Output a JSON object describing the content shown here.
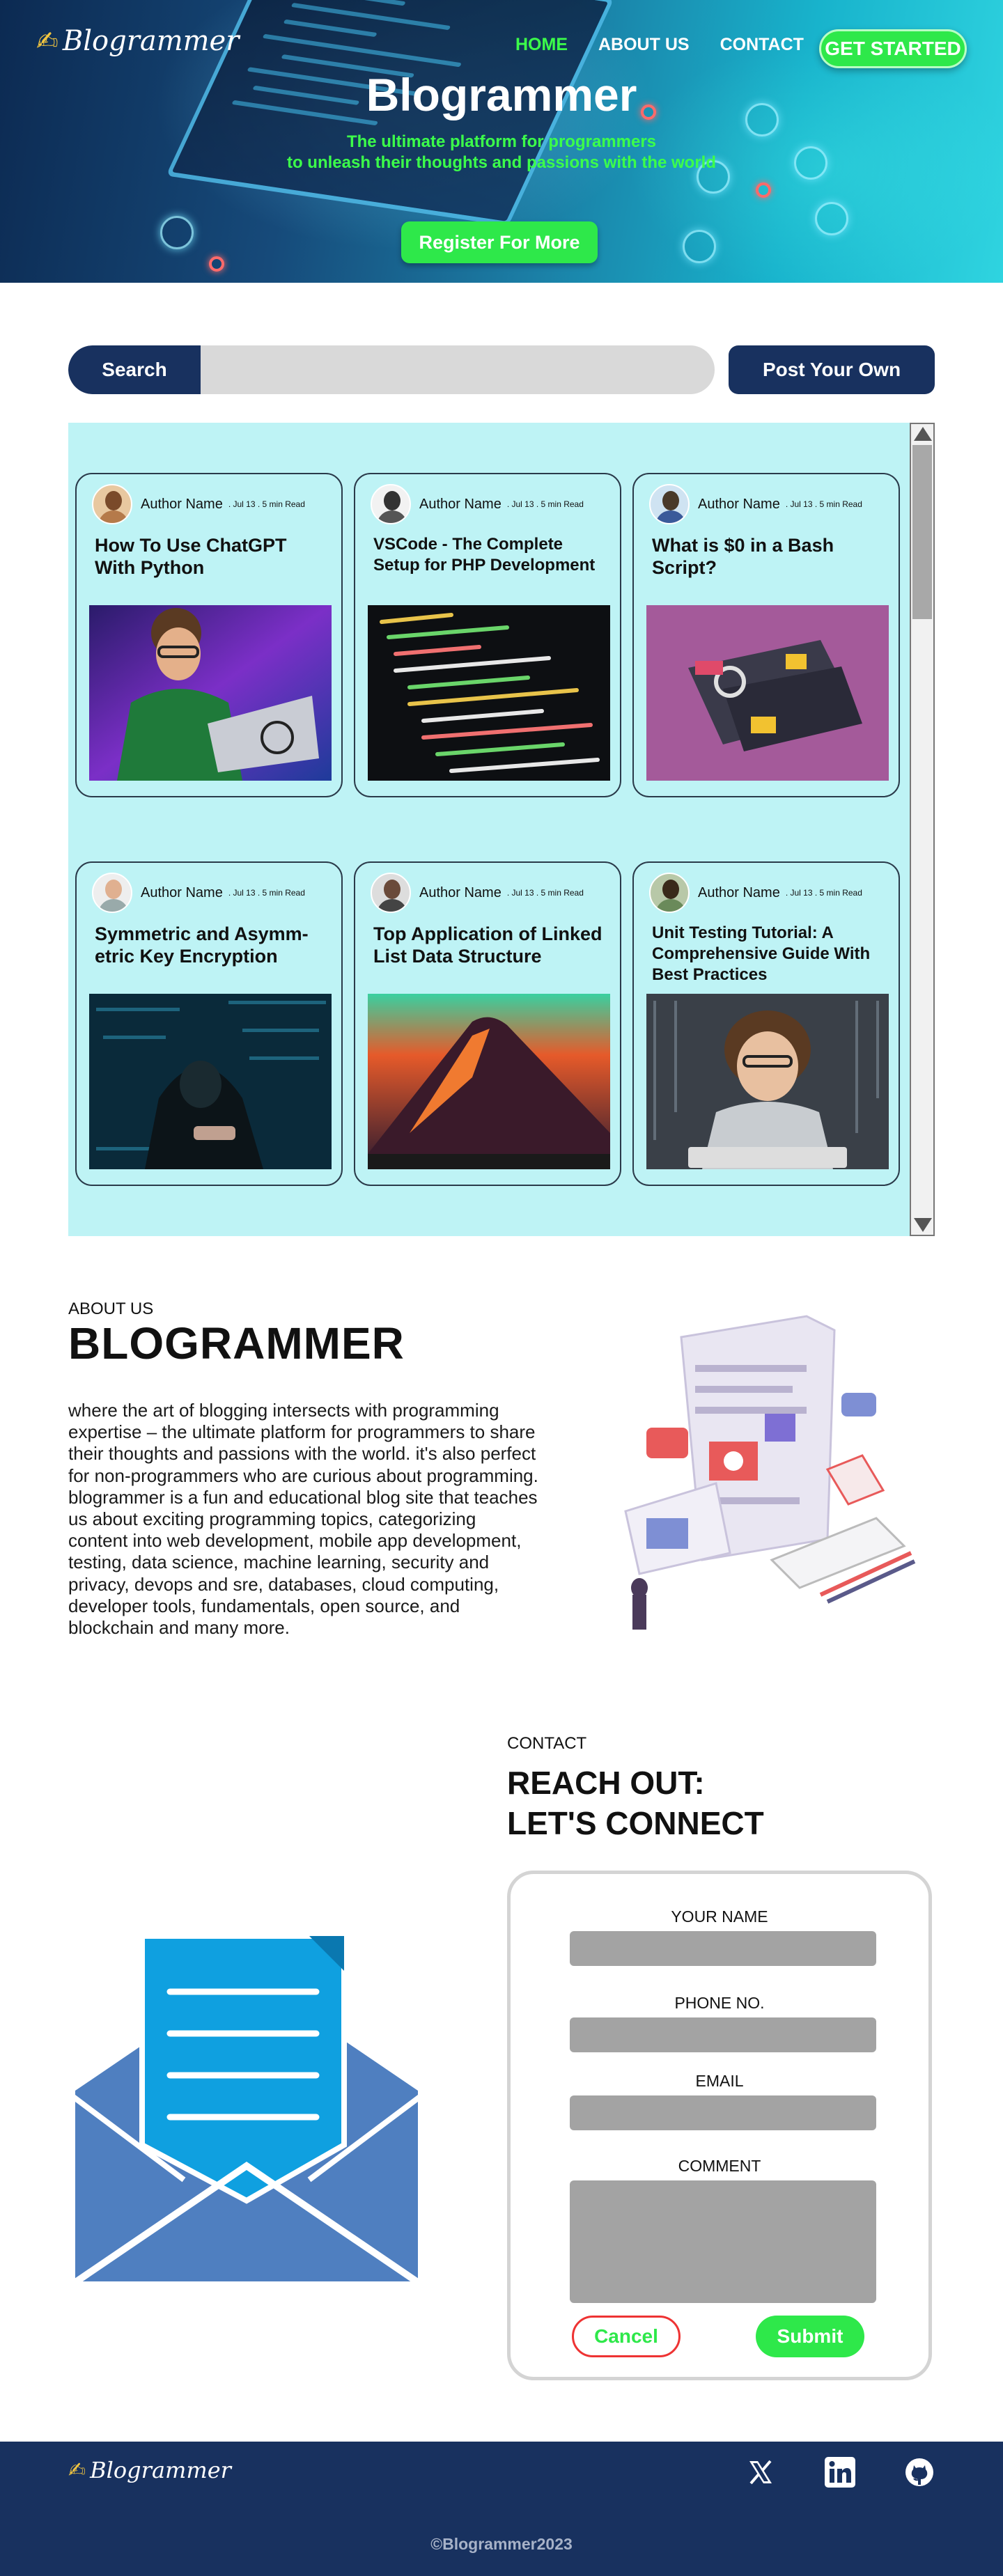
{
  "header": {
    "logo_text": "Blogrammer",
    "nav": [
      {
        "label": "HOME",
        "active": true
      },
      {
        "label": "ABOUT US",
        "active": false
      },
      {
        "label": "CONTACT",
        "active": false
      }
    ],
    "cta_label": "GET STARTED",
    "title": "Blogrammer",
    "subtitle_line1": "The ultimate platform for programmers",
    "subtitle_line2": "to unleash their thoughts and passions with the world",
    "register_label": "Register For More",
    "accent_color": "#2ee84a"
  },
  "search": {
    "button_label": "Search",
    "input_value": "",
    "input_placeholder": "",
    "post_label": "Post Your Own"
  },
  "posts": [
    {
      "author": "Author Name",
      "meta": ". Jul 13 . 5 min Read",
      "title": "How To Use ChatGPT With Python",
      "image": "programmer-laptop-illustration"
    },
    {
      "author": "Author Name",
      "meta": ". Jul 13 . 5 min Read",
      "title": "VSCode - The Complete Setup for PHP Development",
      "image": "code-screen-photo"
    },
    {
      "author": "Author Name",
      "meta": ". Jul 13 . 5 min Read",
      "title": "What is $0 in a Bash Script?",
      "image": "terminal-windows-3d"
    },
    {
      "author": "Author Name",
      "meta": ". Jul 13 . 5 min Read",
      "title": "Symmetric and Asymm-etric Key Encryption",
      "image": "hooded-hacker-photo"
    },
    {
      "author": "Author Name",
      "meta": ". Jul 13 . 5 min Read",
      "title": "Top Application of Linked List Data Structure",
      "image": "volcano-landscape"
    },
    {
      "author": "Author Name",
      "meta": ". Jul 13 . 5 min Read",
      "title": "Unit Testing Tutorial: A Comprehensive Guide With Best Practices",
      "image": "kid-at-keyboard-photo"
    }
  ],
  "about": {
    "label": "ABOUT US",
    "title": "BLOGRAMMER",
    "text": "where the art of blogging intersects with programming expertise – the ultimate platform for programmers to share their thoughts and passions with the world. it's also perfect for non-programmers who are curious about programming. blogrammer is a fun and educational blog site that teaches us about exciting programming topics, categorizing content into web development, mobile app development, testing, data science, machine learning, security and privacy, devops and sre, databases, cloud computing, developer tools, fundamentals, open source, and blockchain and many more."
  },
  "contact": {
    "label": "CONTACT",
    "title_line1": "REACH OUT:",
    "title_line2": "LET'S CONNECT",
    "fields": [
      {
        "label": "YOUR NAME",
        "value": ""
      },
      {
        "label": "PHONE NO.",
        "value": ""
      },
      {
        "label": "EMAIL",
        "value": ""
      },
      {
        "label": "COMMENT",
        "value": ""
      }
    ],
    "cancel_label": "Cancel",
    "submit_label": "Submit"
  },
  "footer": {
    "logo_text": "Blogrammer",
    "social": [
      "x-icon",
      "linkedin-icon",
      "github-icon"
    ],
    "copyright": "©Blogrammer2023"
  }
}
